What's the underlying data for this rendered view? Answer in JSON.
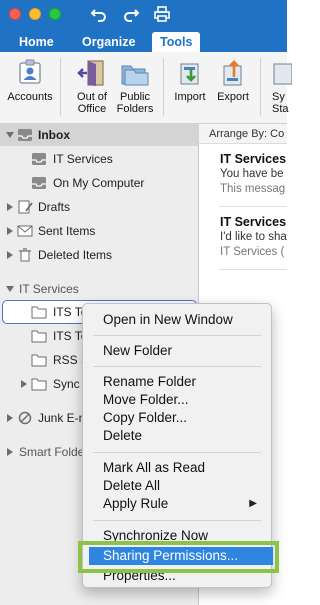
{
  "tabs": [
    {
      "label": "Home"
    },
    {
      "label": "Organize"
    },
    {
      "label": "Tools"
    }
  ],
  "ribbon": {
    "accounts": {
      "line1": "Accounts"
    },
    "out_of_office": {
      "line1": "Out of",
      "line2": "Office"
    },
    "public_folders": {
      "line1": "Public",
      "line2": "Folders"
    },
    "import": {
      "line1": "Import"
    },
    "export": {
      "line1": "Export"
    },
    "sync": {
      "line1": "Sy",
      "line2": "Sta"
    }
  },
  "folders": {
    "inbox": "Inbox",
    "it_services_sub": "IT Services",
    "on_my_computer": "On My Computer",
    "drafts": "Drafts",
    "sent_items": "Sent Items",
    "deleted_items": "Deleted Items",
    "it_services_header": "IT Services",
    "its_te_1": "ITS Te",
    "its_te_2": "ITS Te",
    "rss": "RSS S",
    "sync": "Sync",
    "junk": "Junk E-m",
    "smart_folders": "Smart Folde"
  },
  "list": {
    "arrange_by": "Arrange By: Co",
    "messages": [
      {
        "from": "IT Services",
        "subject": "You have be",
        "preview": "This messag"
      },
      {
        "from": "IT Services",
        "subject": "I'd like to sha",
        "preview": "IT Services ("
      }
    ]
  },
  "context_menu": {
    "items": [
      {
        "label": "Open in New Window"
      },
      {
        "label": "New Folder"
      },
      {
        "label": "Rename Folder"
      },
      {
        "label": "Move Folder..."
      },
      {
        "label": "Copy Folder..."
      },
      {
        "label": "Delete"
      },
      {
        "label": "Mark All as Read"
      },
      {
        "label": "Delete All"
      },
      {
        "label": "Apply Rule"
      },
      {
        "label": "Synchronize Now"
      },
      {
        "label": "Sharing Permissions..."
      },
      {
        "label": "Properties..."
      }
    ],
    "submenu_arrow": "▶"
  },
  "colors": {
    "accent": "#1f72c4",
    "highlight_outline": "#8bc34a",
    "menu_selection": "#2f86e1"
  }
}
